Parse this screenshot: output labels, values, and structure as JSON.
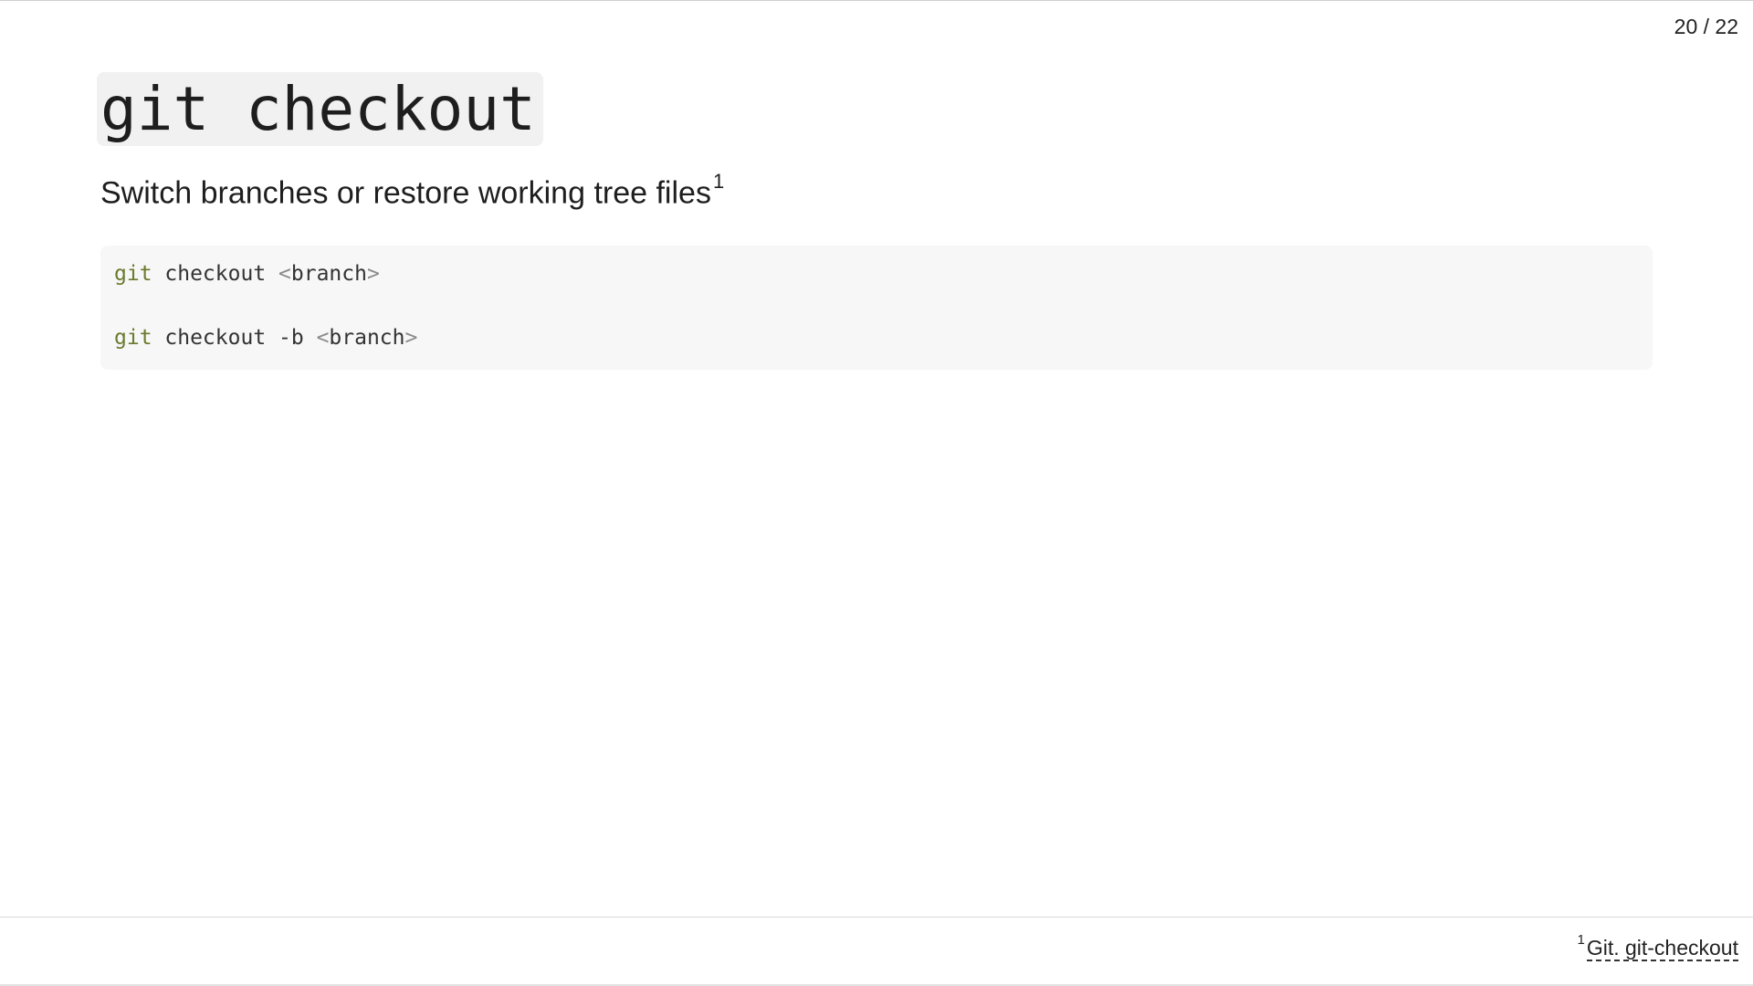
{
  "pager": {
    "text": "20 / 22"
  },
  "slide": {
    "title": "git checkout",
    "subtitle": "Switch branches or restore working tree files",
    "subtitle_ref": "1",
    "code": {
      "line1": {
        "cmd": "git",
        "args": " checkout ",
        "lt": "<",
        "param": "branch",
        "gt": ">"
      },
      "line2": {
        "cmd": "git",
        "args": " checkout -b ",
        "lt": "<",
        "param": "branch",
        "gt": ">"
      }
    }
  },
  "footnote": {
    "ref": "1",
    "link_text": "Git. git-checkout"
  },
  "colors": {
    "keyword": "#6b7a2e",
    "code_bg": "#f7f7f7",
    "title_bg": "#f1f1f1"
  }
}
